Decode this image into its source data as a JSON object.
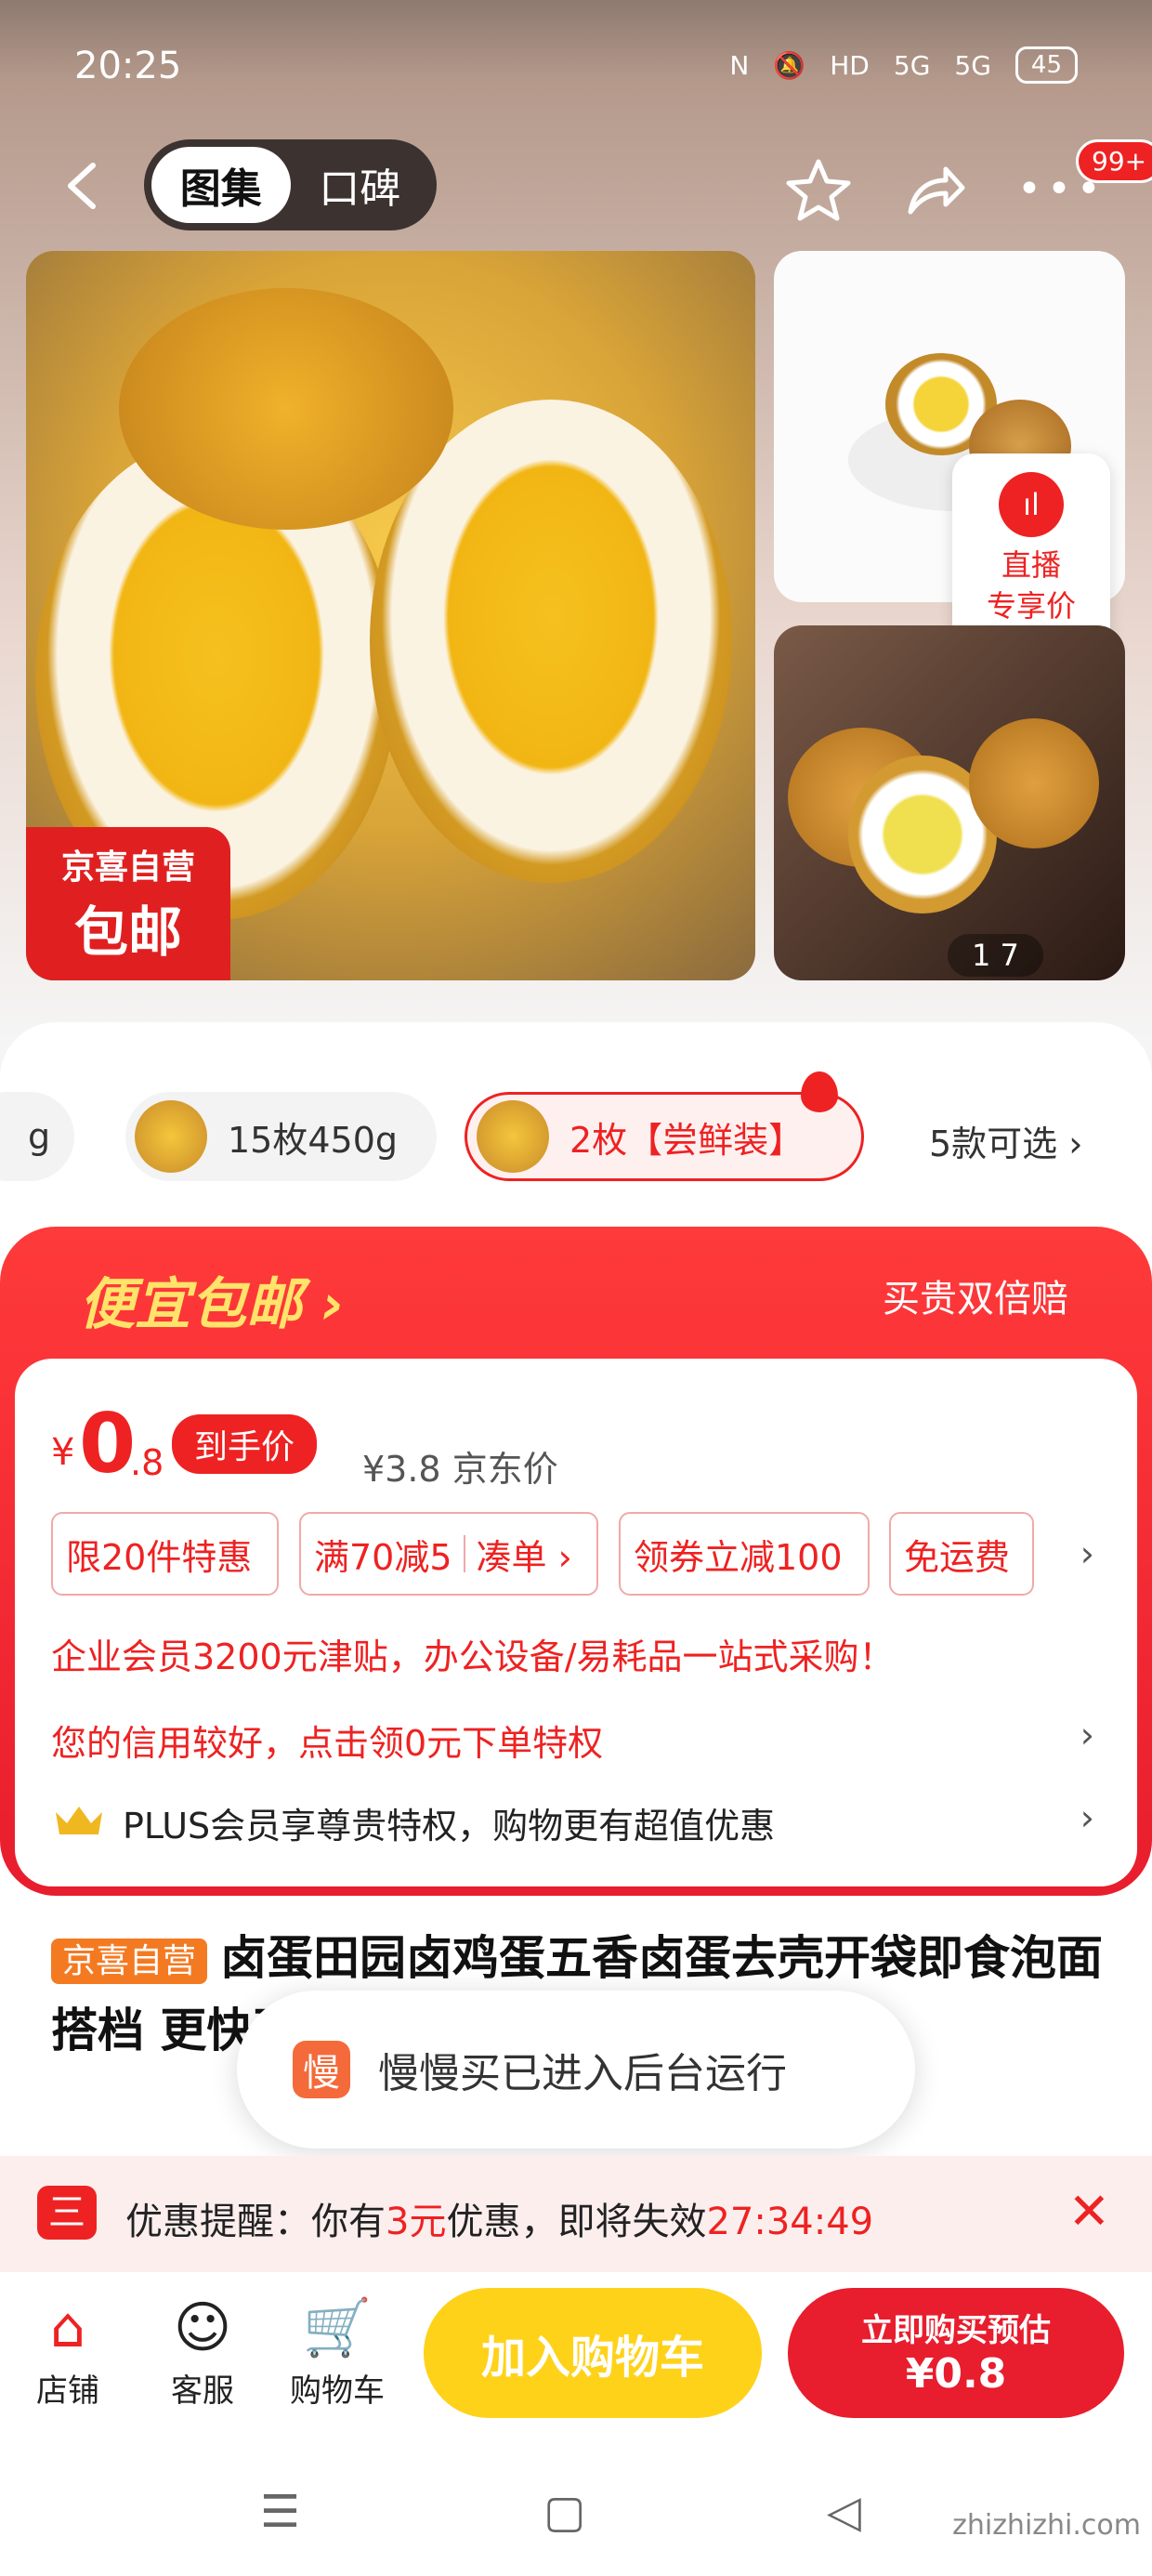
{
  "status_bar": {
    "time": "20:25",
    "icons": [
      "N",
      "🔕",
      "HD",
      "5G",
      "5G"
    ],
    "battery": "45"
  },
  "nav": {
    "tab_active": "图集",
    "tab_inactive": "口碑",
    "more_badge": "99+"
  },
  "gallery": {
    "self_badge_line1": "京喜自营",
    "self_badge_line2": "包邮",
    "live_line1": "直播",
    "live_line2": "专享价",
    "pager": "1 7"
  },
  "variants": {
    "chip_partial": "g",
    "chip1": "15枚450g",
    "chip2": "2枚【尝鲜装】",
    "more": "5款可选 ›"
  },
  "promo": {
    "headline": "便宜包邮 ›",
    "guarantee": "买贵双倍赔"
  },
  "price": {
    "symbol": "¥",
    "integer": "0",
    "decimal": ".8",
    "label": "到手价",
    "jd_price": "¥3.8 京东价"
  },
  "tags": [
    "限20件特惠",
    "满70减5",
    "凑单 ›",
    "领券立减100",
    "免运费"
  ],
  "lines": {
    "enterprise": "企业会员3200元津贴，办公设备/易耗品一站式采购！",
    "credit": "您的信用较好，点击领0元下单特权",
    "plus": "PLUS会员享尊贵特权，购物更有超值优惠"
  },
  "product": {
    "badge": "京喜自营",
    "title": "卤蛋田园卤鸡蛋五香卤蛋去壳开袋即食泡面搭档 更快更好"
  },
  "toast": {
    "icon": "慢",
    "text": "慢慢买已进入后台运行"
  },
  "reminder": {
    "icon": "三",
    "prefix": "优惠提醒：你有",
    "amount": "3元",
    "suffix": "优惠，即将失效",
    "countdown": "27:34:49"
  },
  "bottom": {
    "store": "店铺",
    "service": "客服",
    "cart": "购物车",
    "add_to_cart": "加入购物车",
    "buy_line1": "立即购买预估",
    "buy_line2": "¥0.8"
  },
  "watermark": "zhizhizhi.com",
  "colors": {
    "accent": "#e81d2d",
    "yellow": "#ffd21a",
    "orange": "#f47a22"
  }
}
